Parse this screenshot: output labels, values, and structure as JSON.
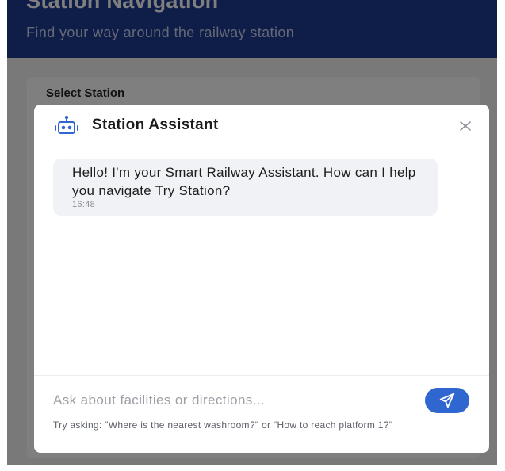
{
  "app": {
    "title": "Station Navigation",
    "subtitle": "Find your way around the railway station"
  },
  "station_card": {
    "label": "Select Station"
  },
  "assistant": {
    "title": "Station Assistant",
    "title_icon": "robot-icon",
    "close_icon": "close-icon",
    "messages": [
      {
        "sender": "assistant",
        "text": "Hello! I'm your Smart Railway Assistant. How can I help you navigate Try Station?",
        "time": "16:48"
      }
    ],
    "input": {
      "value": "",
      "placeholder": "Ask about facilities or directions..."
    },
    "send_icon": "send-icon",
    "hint": "Try asking: \"Where is the nearest washroom?\" or \"How to reach platform 1?\""
  },
  "colors": {
    "header_bg": "#1f3a93",
    "accent": "#2f66d0",
    "bubble_bg": "#f0f2f5"
  }
}
